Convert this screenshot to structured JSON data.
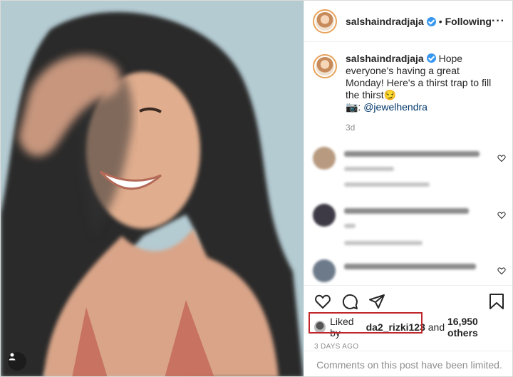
{
  "post": {
    "username": "salshaindradjaja",
    "follow_state": "Following",
    "dot": "•",
    "more": "···",
    "caption_text": "Hope everyone's having a great Monday! Here's a thirst trap to fill the thirst😏",
    "camera_prefix": "📷: ",
    "mention": "@jewelhendra",
    "time": "3d"
  },
  "comments_blurred": [
    {
      "avatar_color": "#b89a80"
    },
    {
      "avatar_color": "#3d3a45"
    },
    {
      "avatar_color": "#6d7a8a"
    }
  ],
  "likes": {
    "prefix": "Liked by",
    "liker": "da2_rizki123",
    "connector": "and",
    "others": "16,950 others"
  },
  "posted_ago": "3 DAYS AGO",
  "comments_limited": "Comments on this post have been limited.",
  "icons": [
    "heart-icon",
    "comment-icon",
    "share-icon",
    "bookmark-icon",
    "more-icon",
    "verified-icon",
    "user-tag-icon"
  ],
  "colors": {
    "verified": "#3897f0",
    "highlight_box": "#c0262a",
    "muted": "#8e8e8e",
    "mention": "#00376b"
  }
}
